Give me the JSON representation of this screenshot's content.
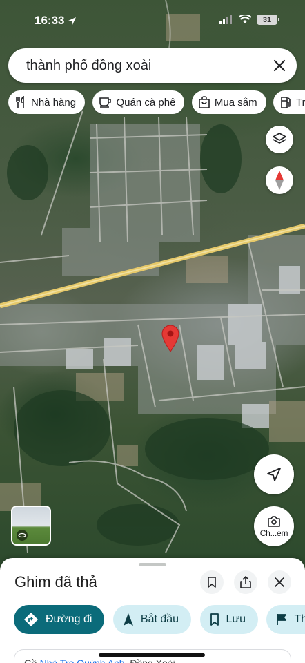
{
  "status_bar": {
    "time": "16:33",
    "battery": "31"
  },
  "search": {
    "query": "thành phố đồng xoài"
  },
  "chips": [
    {
      "icon": "restaurant-icon",
      "label": "Nhà hàng"
    },
    {
      "icon": "coffee-icon",
      "label": "Quán cà phê"
    },
    {
      "icon": "shopping-bag-icon",
      "label": "Mua sắm"
    },
    {
      "icon": "gas-station-icon",
      "label": "Trạm"
    }
  ],
  "map": {
    "lens_label": "Ch...em"
  },
  "sheet": {
    "title": "Ghim đã thả",
    "actions": [
      {
        "icon": "directions-icon",
        "label": "Đường đi"
      },
      {
        "icon": "navigation-arrow-icon",
        "label": "Bắt đầu"
      },
      {
        "icon": "bookmark-icon",
        "label": "Lưu"
      },
      {
        "icon": "flag-icon",
        "label": "Thê"
      }
    ],
    "info_prefix": "Gầ",
    "info_link": "Nhà Trọ Quỳnh Anh",
    "info_suffix": ", Đồng Xoài"
  },
  "colors": {
    "primary": "#0b6b7a",
    "secondary": "#d3eef4",
    "pin": "#e53935"
  }
}
